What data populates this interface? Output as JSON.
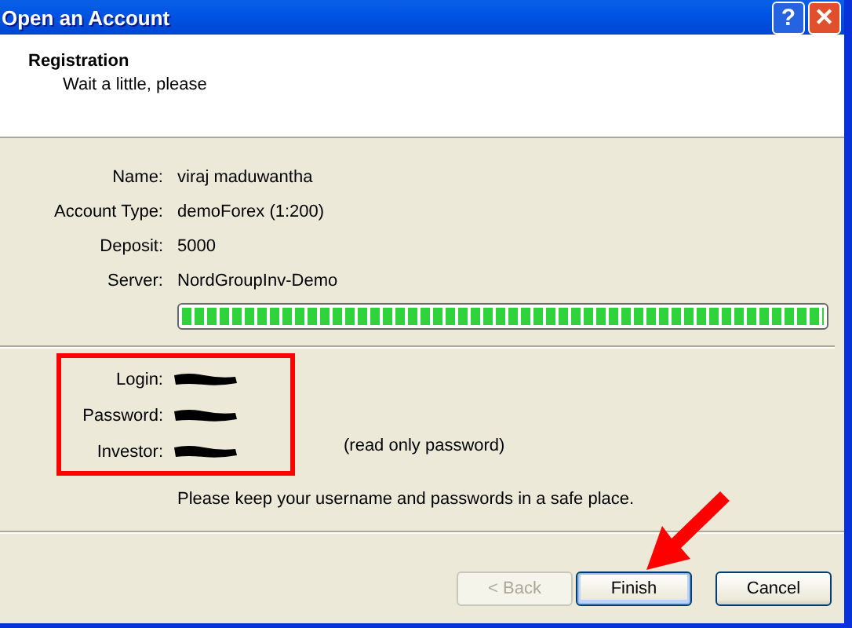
{
  "window": {
    "title": "Open an Account",
    "help_glyph": "?",
    "close_glyph": "✕"
  },
  "header": {
    "title": "Registration",
    "subtitle": "Wait a little, please"
  },
  "details": [
    {
      "label": "Name:",
      "value": "viraj maduwantha"
    },
    {
      "label": "Account Type:",
      "value": "demoForex (1:200)"
    },
    {
      "label": "Deposit:",
      "value": "5000"
    },
    {
      "label": "Server:",
      "value": "NordGroupInv-Demo"
    }
  ],
  "progress": {
    "level": 1
  },
  "credentials": [
    {
      "label": "Login:",
      "kind": "redacted"
    },
    {
      "label": "Password:",
      "kind": "redacted"
    },
    {
      "label": "Investor:",
      "kind": "redacted",
      "note": "(read only password)"
    }
  ],
  "notice": "Please keep your username and passwords in a safe place.",
  "buttons": [
    {
      "label": "< Back",
      "disabled": true,
      "default": false
    },
    {
      "label": "Finish",
      "disabled": false,
      "default": true
    },
    {
      "label": "Cancel",
      "disabled": false,
      "default": false
    }
  ]
}
